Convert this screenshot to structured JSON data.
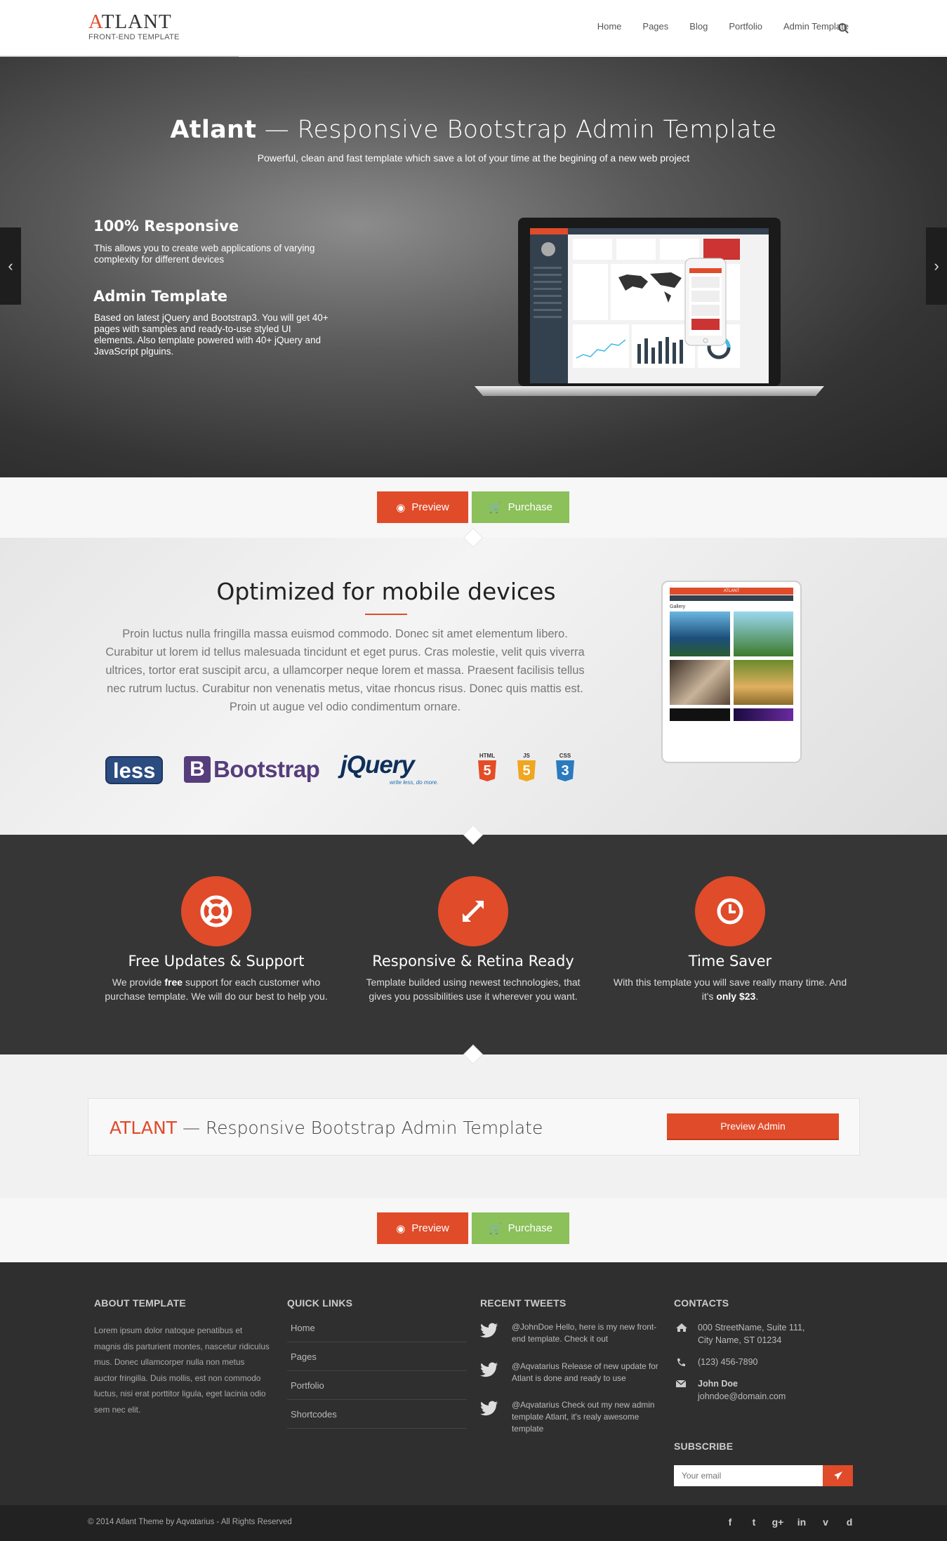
{
  "header": {
    "logo_main": "TLANT",
    "logo_initial": "A",
    "logo_sub": "FRONT-END TEMPLATE",
    "nav": [
      "Home",
      "Pages",
      "Blog",
      "Portfolio",
      "Admin Template"
    ]
  },
  "hero": {
    "title_bold": "Atlant",
    "title_rest": " — Responsive Bootstrap Admin Template",
    "subtitle": "Powerful, clean and fast template which save a lot of your time at the begining of a new web project",
    "features": [
      {
        "title": "100% Responsive",
        "text": "This allows you to create web applications of varying complexity for different devices"
      },
      {
        "title": "Admin Template",
        "text": "Based on latest jQuery and Bootstrap3. You will get 40+ pages with samples and ready-to-use styled UI elements. Also template powered with 40+ jQuery and JavaScript plguins."
      }
    ],
    "prev_arrow": "‹",
    "next_arrow": "›"
  },
  "buttons": {
    "preview": "Preview",
    "purchase": "Purchase"
  },
  "mobile_section": {
    "title": "Optimized for mobile devices",
    "text": "Proin luctus nulla fringilla massa euismod commodo. Donec sit amet elementum libero. Curabitur ut lorem id tellus malesuada tincidunt et eget purus. Cras molestie, velit quis viverra ultrices, tortor erat suscipit arcu, a ullamcorper neque lorem et massa. Praesent facilisis tellus nec rutrum luctus. Curabitur non venenatis metus, vitae rhoncus risus. Donec quis mattis est. Proin ut augue vel odio condimentum ornare.",
    "logos": {
      "less": "less",
      "bootstrap_b": "B",
      "bootstrap": "Bootstrap",
      "jquery": "jQuery",
      "jquery_tag": "write less, do more.",
      "html": "HTML",
      "js": "JS",
      "css": "CSS",
      "html_n": "5",
      "js_n": "5",
      "css_n": "3"
    },
    "tablet_brand": "ATLANT",
    "tablet_gallery": "Gallery"
  },
  "features": [
    {
      "title": "Free Updates & Support",
      "text_a": "We provide ",
      "text_b": "free",
      "text_c": " support for each customer who purchase template. We will do our best to help you."
    },
    {
      "title": "Responsive & Retina Ready",
      "text_a": "Template builded using newest technologies, that gives you possibilities use it wherever you want.",
      "text_b": "",
      "text_c": ""
    },
    {
      "title": "Time Saver",
      "text_a": "With this template you will save really many time. And it's ",
      "text_b": "only $23",
      "text_c": "."
    }
  ],
  "callout": {
    "brand": "ATLANT",
    "rest": " — Responsive Bootstrap Admin Template",
    "button": "Preview Admin"
  },
  "footer": {
    "about_title": "ABOUT TEMPLATE",
    "about_text": "Lorem ipsum dolor natoque penatibus et magnis dis parturient montes, nascetur ridiculus mus. Donec ullamcorper nulla non metus auctor fringilla. Duis mollis, est non commodo luctus, nisi erat porttitor ligula, eget lacinia odio sem nec elit.",
    "links_title": "QUICK LINKS",
    "links": [
      "Home",
      "Pages",
      "Portfolio",
      "Shortcodes"
    ],
    "tweets_title": "RECENT TWEETS",
    "tweets": [
      {
        "handle": "@JohnDoe",
        "text": " Hello, here is my new front-end template. Check it out"
      },
      {
        "handle": "@Aqvatarius",
        "text": " Release of new update for Atlant is done and ready to use"
      },
      {
        "handle": "@Aqvatarius",
        "text": " Check out my new admin template Atlant, it's realy awesome template"
      }
    ],
    "contacts_title": "CONTACTS",
    "address_1": "000 StreetName, Suite 111,",
    "address_2": "City Name, ST 01234",
    "phone": "(123) 456-7890",
    "contact_name": "John Doe",
    "email": "johndoe@domain.com",
    "subscribe_title": "SUBSCRIBE",
    "subscribe_placeholder": "Your email",
    "copyright": "© 2014 Atlant Theme by Aqvatarius - All Rights Reserved",
    "social": [
      "f",
      "t",
      "g+",
      "in",
      "v",
      "d"
    ]
  },
  "colors": {
    "accent": "#e04b2a",
    "green": "#8bc05a",
    "dark": "#363636",
    "footer": "#2f2f2f"
  }
}
